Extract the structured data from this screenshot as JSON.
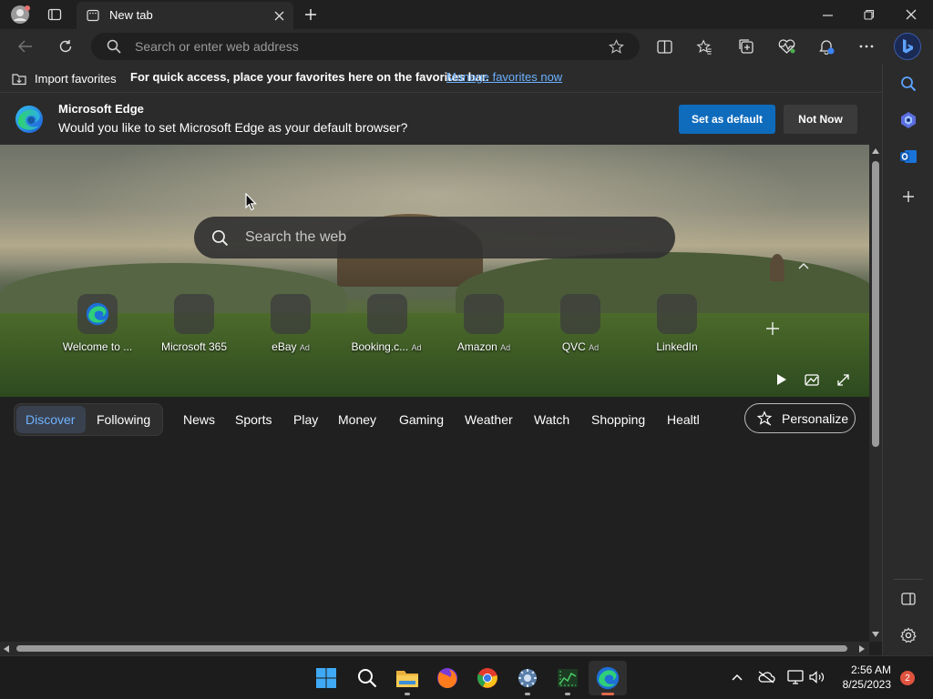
{
  "titlebar": {
    "tab_title": "New tab",
    "new_tab_icon": "plus-icon",
    "window_controls": [
      "minimize-icon",
      "restore-icon",
      "close-icon"
    ]
  },
  "toolbar": {
    "address_placeholder": "Search or enter web address"
  },
  "favorites_bar": {
    "import_label": "Import favorites",
    "hint": "For quick access, place your favorites here on the favorites bar.",
    "manage_link": "Manage favorites now"
  },
  "infobar": {
    "title": "Microsoft Edge",
    "message": "Would you like to set Microsoft Edge as your default browser?",
    "set_default": "Set as default",
    "not_now": "Not Now",
    "accent": "#0f6cbd"
  },
  "newtab": {
    "search_placeholder": "Search the web",
    "tiles": [
      {
        "label": "Welcome to ...",
        "ad": ""
      },
      {
        "label": "Microsoft 365",
        "ad": ""
      },
      {
        "label": "eBay",
        "ad": "Ad"
      },
      {
        "label": "Booking.c...",
        "ad": "Ad"
      },
      {
        "label": "Amazon",
        "ad": "Ad"
      },
      {
        "label": "QVC",
        "ad": "Ad"
      },
      {
        "label": "LinkedIn",
        "ad": ""
      }
    ],
    "nav": {
      "discover": "Discover",
      "following": "Following",
      "items": [
        "News",
        "Sports",
        "Play",
        "Money",
        "Gaming",
        "Weather",
        "Watch",
        "Shopping",
        "Healtl"
      ],
      "personalize": "Personalize"
    }
  },
  "taskbar": {
    "time": "2:56 AM",
    "date": "8/25/2023",
    "notification_count": "2"
  }
}
